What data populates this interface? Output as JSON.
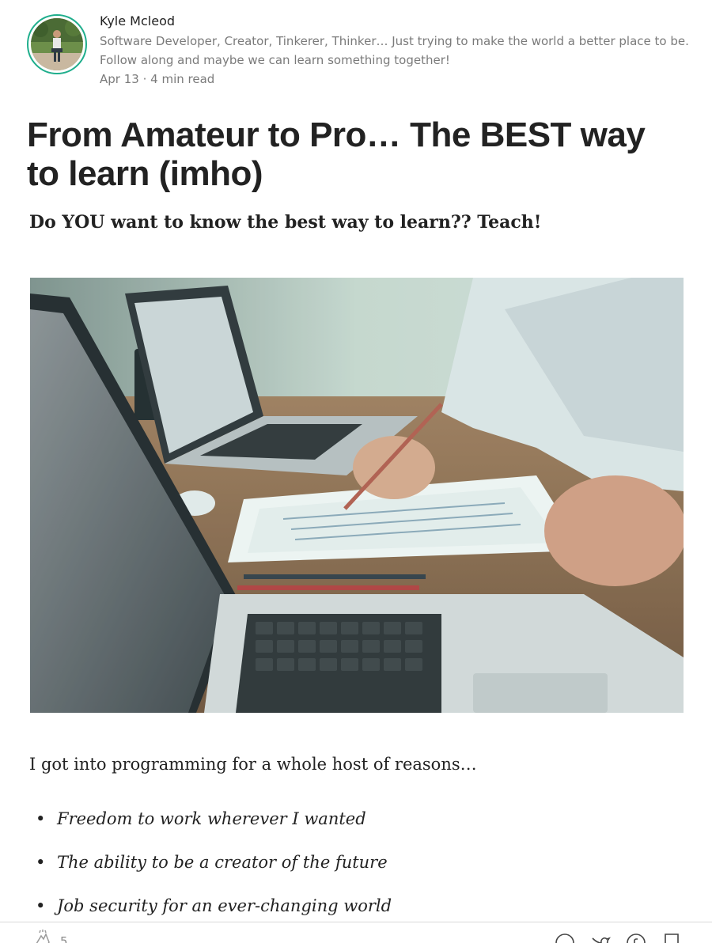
{
  "author": {
    "name": "Kyle Mcleod",
    "bio": "Software Developer, Creator, Tinkerer, Thinker… Just trying to make the world a better place to be. Follow along and maybe we can learn something together!",
    "date": "Apr 13",
    "separator": "·",
    "read_time": "4 min read"
  },
  "article": {
    "title": "From Amateur to Pro… The BEST way to learn (imho)",
    "subtitle": "Do YOU want to know the best way to learn?? Teach!",
    "intro": "I got into programming for a whole host of reasons…",
    "reasons": [
      "Freedom to work wherever I wanted",
      "The ability to be a creator of the future",
      "Job security for an ever-changing world"
    ],
    "bullet": "•"
  },
  "action_bar": {
    "clap_count": "5",
    "icons": [
      "clap-icon",
      "response-icon",
      "twitter-icon",
      "facebook-icon",
      "bookmark-icon"
    ]
  },
  "colors": {
    "accent": "#1fae8c",
    "text": "#222222",
    "muted": "#7a7a7a"
  }
}
